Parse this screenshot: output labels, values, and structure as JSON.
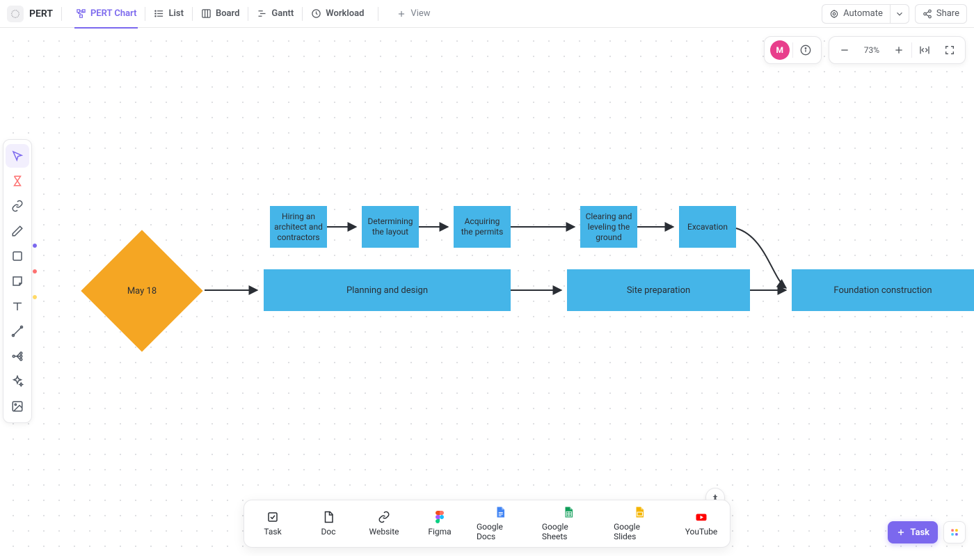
{
  "app": {
    "name": "PERT"
  },
  "tabs": [
    {
      "label": "PERT Chart",
      "active": true
    },
    {
      "label": "List"
    },
    {
      "label": "Board"
    },
    {
      "label": "Gantt"
    },
    {
      "label": "Workload"
    }
  ],
  "addViewLabel": "View",
  "topButtons": {
    "automate": "Automate",
    "share": "Share"
  },
  "user": {
    "initial": "M"
  },
  "zoom": "73%",
  "diagram": {
    "startDate": "May 18",
    "smallNodes": {
      "hiring": "Hiring an architect and contractors",
      "layout": "Determining the layout",
      "permits": "Acquiring the permits",
      "clearing": "Clearing and leveling the ground",
      "excavation": "Excavation"
    },
    "bigNodes": {
      "planning": "Planning and design",
      "site": "Site preparation",
      "foundation": "Foundation construction"
    }
  },
  "bottom": {
    "task": "Task",
    "doc": "Doc",
    "website": "Website",
    "figma": "Figma",
    "gdocs": "Google Docs",
    "gsheets": "Google Sheets",
    "gslides": "Google Slides",
    "youtube": "YouTube"
  },
  "taskButton": "Task",
  "colors": {
    "accent": "#7b68ee",
    "node": "#45b5e8",
    "startNode": "#f5a623",
    "avatar": "#e83e8c"
  }
}
